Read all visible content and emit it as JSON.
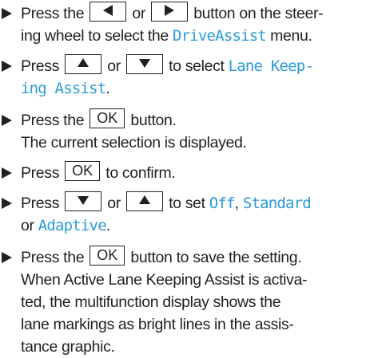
{
  "steps": [
    {
      "parts": {
        "a": "Press the",
        "b": "or",
        "c": "button on the steer-",
        "d": "ing wheel to select the",
        "e": "DriveAssist",
        "f": "menu."
      },
      "keys": [
        "left-arrow-key",
        "right-arrow-key"
      ]
    },
    {
      "parts": {
        "a": "Press",
        "b": "or",
        "c": "to select",
        "d": "Lane Keep-",
        "e": "ing Assist",
        "f": "."
      },
      "keys": [
        "up-arrow-key",
        "down-arrow-key"
      ]
    },
    {
      "parts": {
        "a": "Press the",
        "b": "button.",
        "c": "The current selection is displayed."
      },
      "keys": [
        "ok-key"
      ]
    },
    {
      "parts": {
        "a": "Press",
        "b": "to confirm."
      },
      "keys": [
        "ok-key"
      ]
    },
    {
      "parts": {
        "a": "Press",
        "b": "or",
        "c": "to set",
        "d": "Off",
        "e": ",",
        "f": "Standard",
        "g": "or",
        "h": "Adaptive",
        "i": "."
      },
      "keys": [
        "down-arrow-key",
        "up-arrow-key"
      ]
    },
    {
      "parts": {
        "a": "Press the",
        "b": "button to save the setting.",
        "c": "When Active Lane Keeping Assist is activa-",
        "d": "ted, the multifunction display shows the",
        "e": "lane markings as bright lines in the assis-",
        "f": "tance graphic."
      },
      "keys": [
        "ok-key"
      ]
    }
  ],
  "key_labels": {
    "ok": "OK"
  },
  "colors": {
    "text": "#231f20",
    "highlight": "#2a9ad6"
  }
}
